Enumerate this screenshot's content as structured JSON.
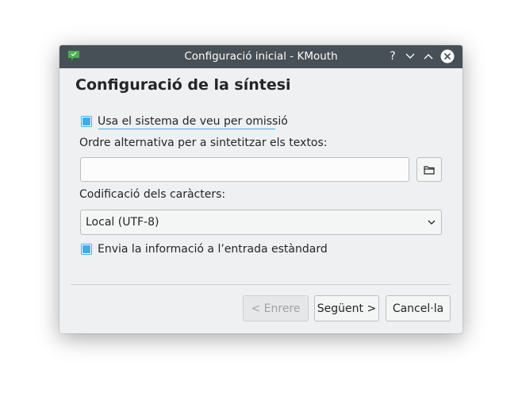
{
  "window": {
    "title": "Configuració inicial - KMouth",
    "controls": {
      "help": "?",
      "minimize": "minimize-icon",
      "maximize": "maximize-icon",
      "close": "close-icon"
    }
  },
  "page": {
    "title": "Configuració de la síntesi"
  },
  "form": {
    "use_default_voice": {
      "label": "Usa el sistema de veu per omissió",
      "checked": true
    },
    "alt_command": {
      "label": "Ordre alternativa per a sintetitzar els textos:",
      "value": "",
      "placeholder": ""
    },
    "encoding": {
      "label": "Codificació dels caràcters:",
      "selected": "Local (UTF-8)"
    },
    "stdin": {
      "label": "Envia la informació a l’entrada estàndard",
      "checked": true
    }
  },
  "footer": {
    "back_label": "< Enrere",
    "next_label": "Següent >",
    "cancel_label": "Cancel·la"
  },
  "colors": {
    "accent": "#3daee9",
    "titlebar": "#475057",
    "window_bg": "#eff0f1"
  }
}
